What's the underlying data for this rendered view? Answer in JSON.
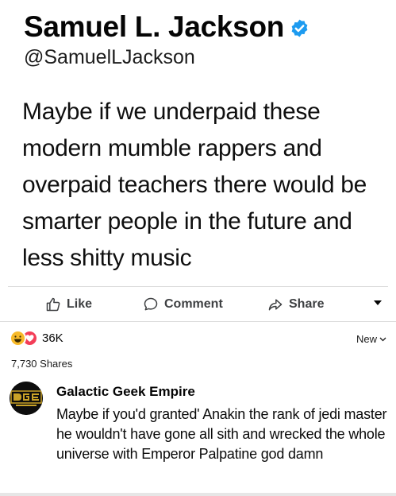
{
  "post": {
    "author": "Samuel L. Jackson",
    "handle": "@SamuelLJackson",
    "text": "Maybe if we underpaid these modern mumble rappers and overpaid teachers there would be smarter people in the future and less shitty music",
    "verified_color": "#1d9bf0"
  },
  "actions": {
    "like": "Like",
    "comment": "Comment",
    "share": "Share"
  },
  "stats": {
    "reaction_count": "36K",
    "shares": "7,730 Shares",
    "sort_label": "New",
    "reactions": [
      "haha-icon",
      "love-icon"
    ]
  },
  "comment": {
    "author": "Galactic Geek Empire",
    "avatar_text": "GGE",
    "text": "Maybe if you'd granted' Anakin the rank of jedi master he wouldn't have gone all sith and wrecked the whole universe with Emperor Palpatine god damn"
  }
}
